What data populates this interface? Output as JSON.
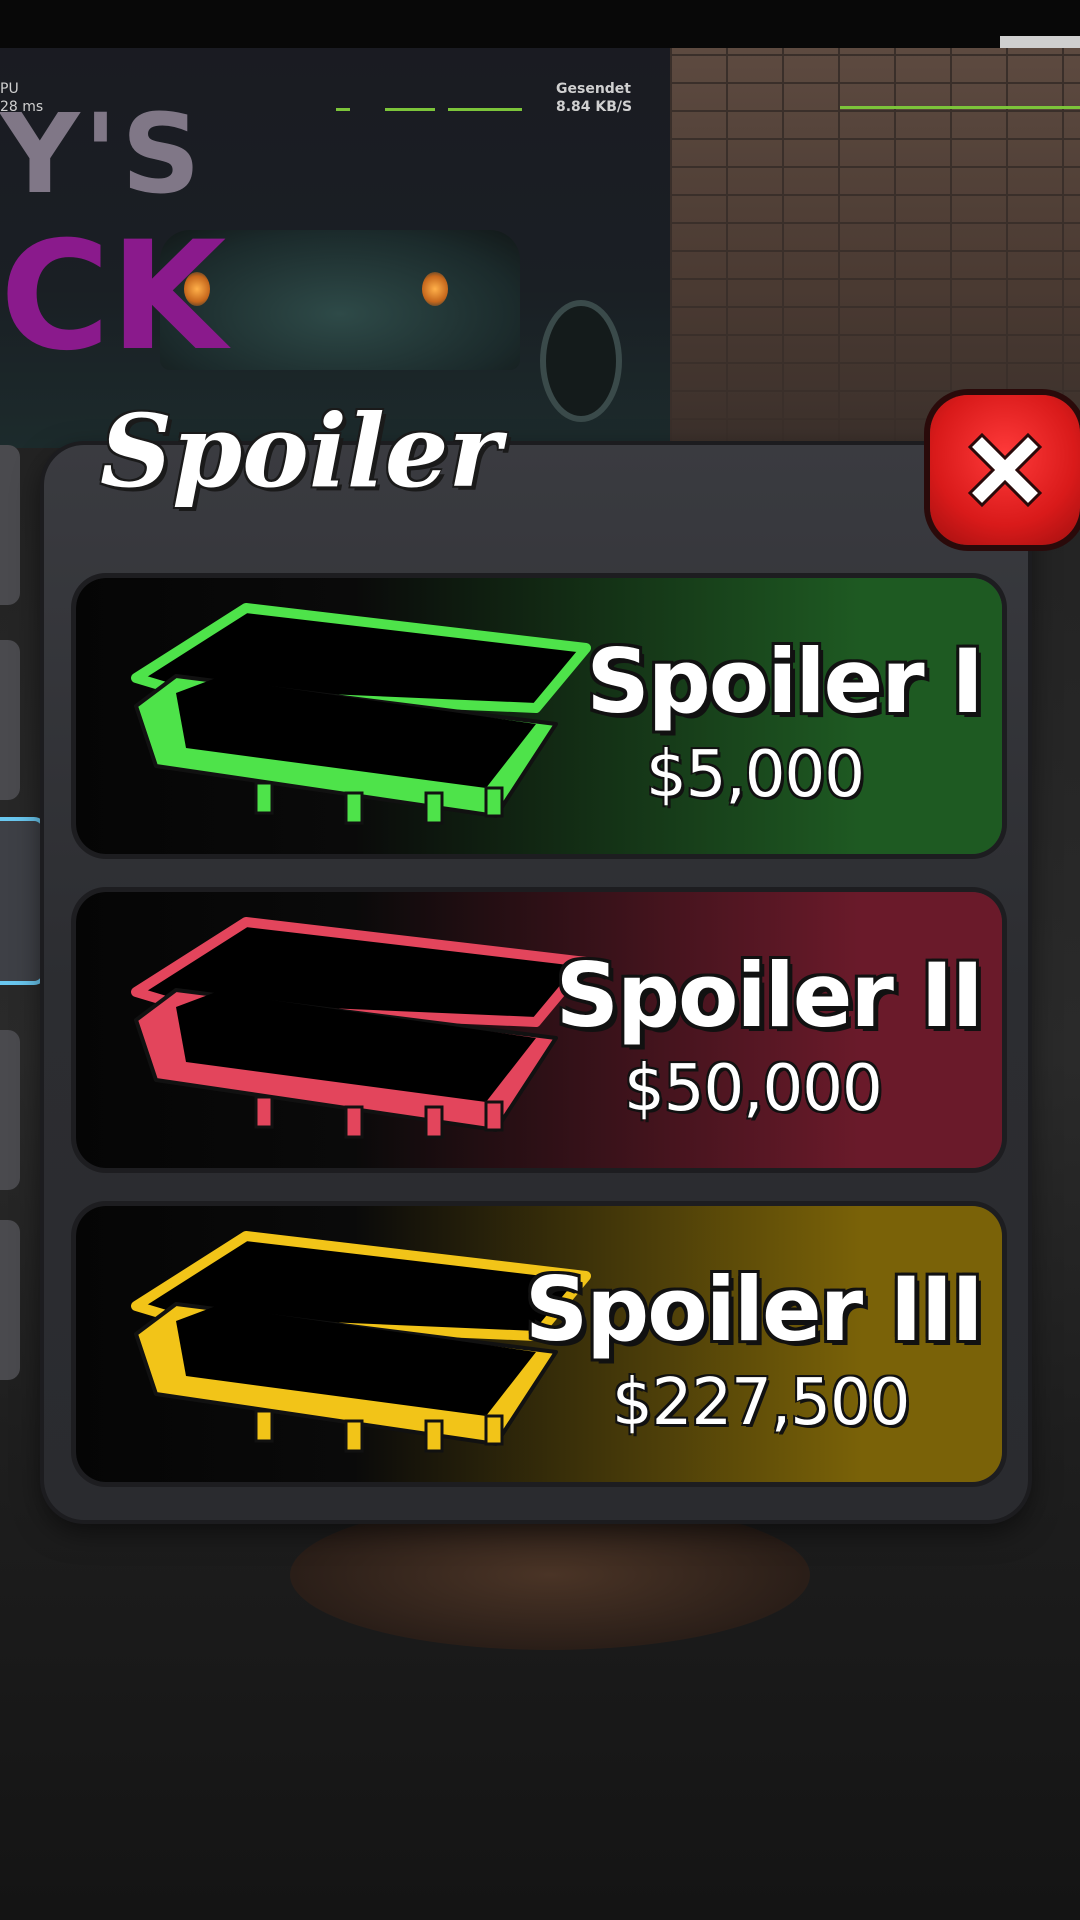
{
  "hud": {
    "cpu_label": "PU",
    "cpu_value": "28 ms",
    "sent_label": "Gesendet",
    "sent_value": "8.84 KB/S"
  },
  "poster": {
    "line1": "Y'S",
    "line2": "CK"
  },
  "panel": {
    "title": "Spoiler",
    "close_icon": "close-x-icon"
  },
  "items": [
    {
      "name": "Spoiler I",
      "price": "$5,000",
      "color": "#4ee34a",
      "bg": "#1e5a22",
      "icon": "spoiler-case-icon"
    },
    {
      "name": "Spoiler II",
      "price": "$50,000",
      "color": "#e3455c",
      "bg": "#6a1a2a",
      "icon": "spoiler-case-icon"
    },
    {
      "name": "Spoiler III",
      "price": "$227,500",
      "color": "#f2c418",
      "bg": "#7a6208",
      "icon": "spoiler-case-icon"
    }
  ],
  "colors": {
    "panel": "#2e2f34",
    "close": "#e21f1f",
    "selected_tab": "#6ac8f0"
  }
}
